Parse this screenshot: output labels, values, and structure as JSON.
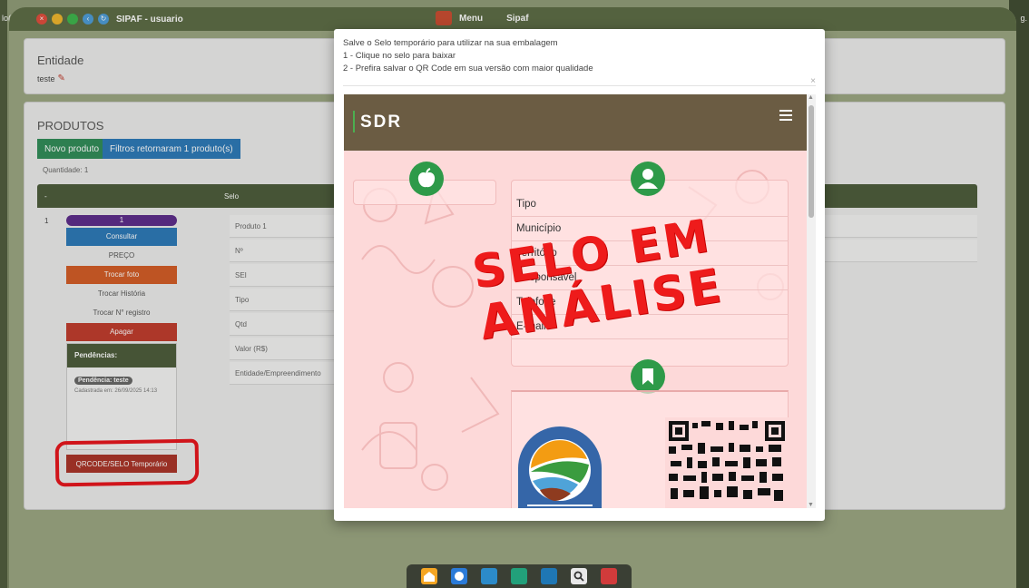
{
  "os": {
    "left_label": "lo(a)",
    "right_label": "g."
  },
  "window": {
    "title": "SIPAF - usuario",
    "menu_label": "Menu",
    "app_label": "Sipaf"
  },
  "entidade": {
    "title": "Entidade",
    "value": "teste"
  },
  "produtos": {
    "title": "PRODUTOS",
    "novo_button": "Novo produto",
    "filtros_button": "Filtros retornaram 1 produto(s)",
    "quantidade": "Quantidade: 1",
    "table_headers": [
      "-",
      "Selo"
    ],
    "row_number": "1",
    "badge": "1",
    "actions": {
      "consultar": "Consultar",
      "preco": "PREÇO",
      "trocar_foto": "Trocar foto",
      "trocar_historia": "Trocar História",
      "trocar_registro": "Trocar N° registro",
      "apagar": "Apagar"
    },
    "pendencias": {
      "title": "Pendências:",
      "badge": "Pendência: teste",
      "date": "Cadastrada em: 26/09/2025 14:13"
    },
    "qrcode_button": "QRCODE/SELO Temporário",
    "fields": [
      "Produto 1",
      "Nº",
      "SEI",
      "Tipo",
      "Qtd",
      "Valor (R$)",
      "Entidade/Empreendimento"
    ]
  },
  "modal": {
    "lines": [
      "Salve o Selo temporário para utilizar na sua embalagem",
      "1 - Clique no selo para baixar",
      "2 - Prefira salvar o QR Code em sua versão com maior qualidade"
    ],
    "close": "×",
    "selo": {
      "brand": "SDR",
      "rows": [
        "Tipo",
        "Município",
        "Território",
        "Responsável",
        "Telefone",
        "E-mails"
      ],
      "stamp_line1": "SELO EM",
      "stamp_line2": "ANÁLISE"
    }
  },
  "colors": {
    "brand_bar": "#6b5c43",
    "accent_green": "#2e9a49",
    "stamp_red": "#ee1b1b",
    "viewer_bg": "#fdd9d9"
  }
}
